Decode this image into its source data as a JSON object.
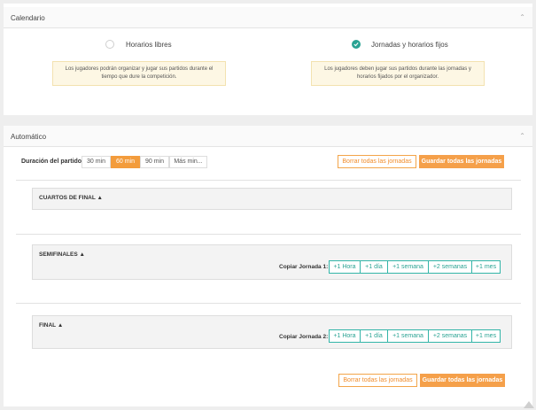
{
  "calendario": {
    "title": "Calendario",
    "options": [
      {
        "label": "Horarios libres",
        "selected": false,
        "note": "Los jugadores podrán organizar y jugar sus partidos durante el tiempo que dure la competición."
      },
      {
        "label": "Jornadas y horarios fijos",
        "selected": true,
        "note": "Los jugadores deben jugar sus partidos durante las jornadas y horarios fijados por el organizador."
      }
    ]
  },
  "automatico": {
    "title": "Automático",
    "duration_label": "Duración del partido:",
    "durations": [
      "30 min",
      "60 min",
      "90 min",
      "Más min..."
    ],
    "selected_duration": "60 min",
    "clear_all": "Borrar todas las jornadas",
    "save_all": "Guardar todas las jornadas",
    "phases": [
      {
        "name": "CUARTOS DE FINAL"
      },
      {
        "name": "SEMIFINALES",
        "copy_label": "Copiar Jornada 1:"
      },
      {
        "name": "FINAL",
        "copy_label": "Copiar Jornada 2:"
      }
    ],
    "copy_options": [
      "+1 Hora",
      "+1 día",
      "+1 semana",
      "+2 semanas",
      "+1 mes"
    ]
  },
  "colors": {
    "accent": "#f39c3c",
    "teal": "#2aa393"
  }
}
